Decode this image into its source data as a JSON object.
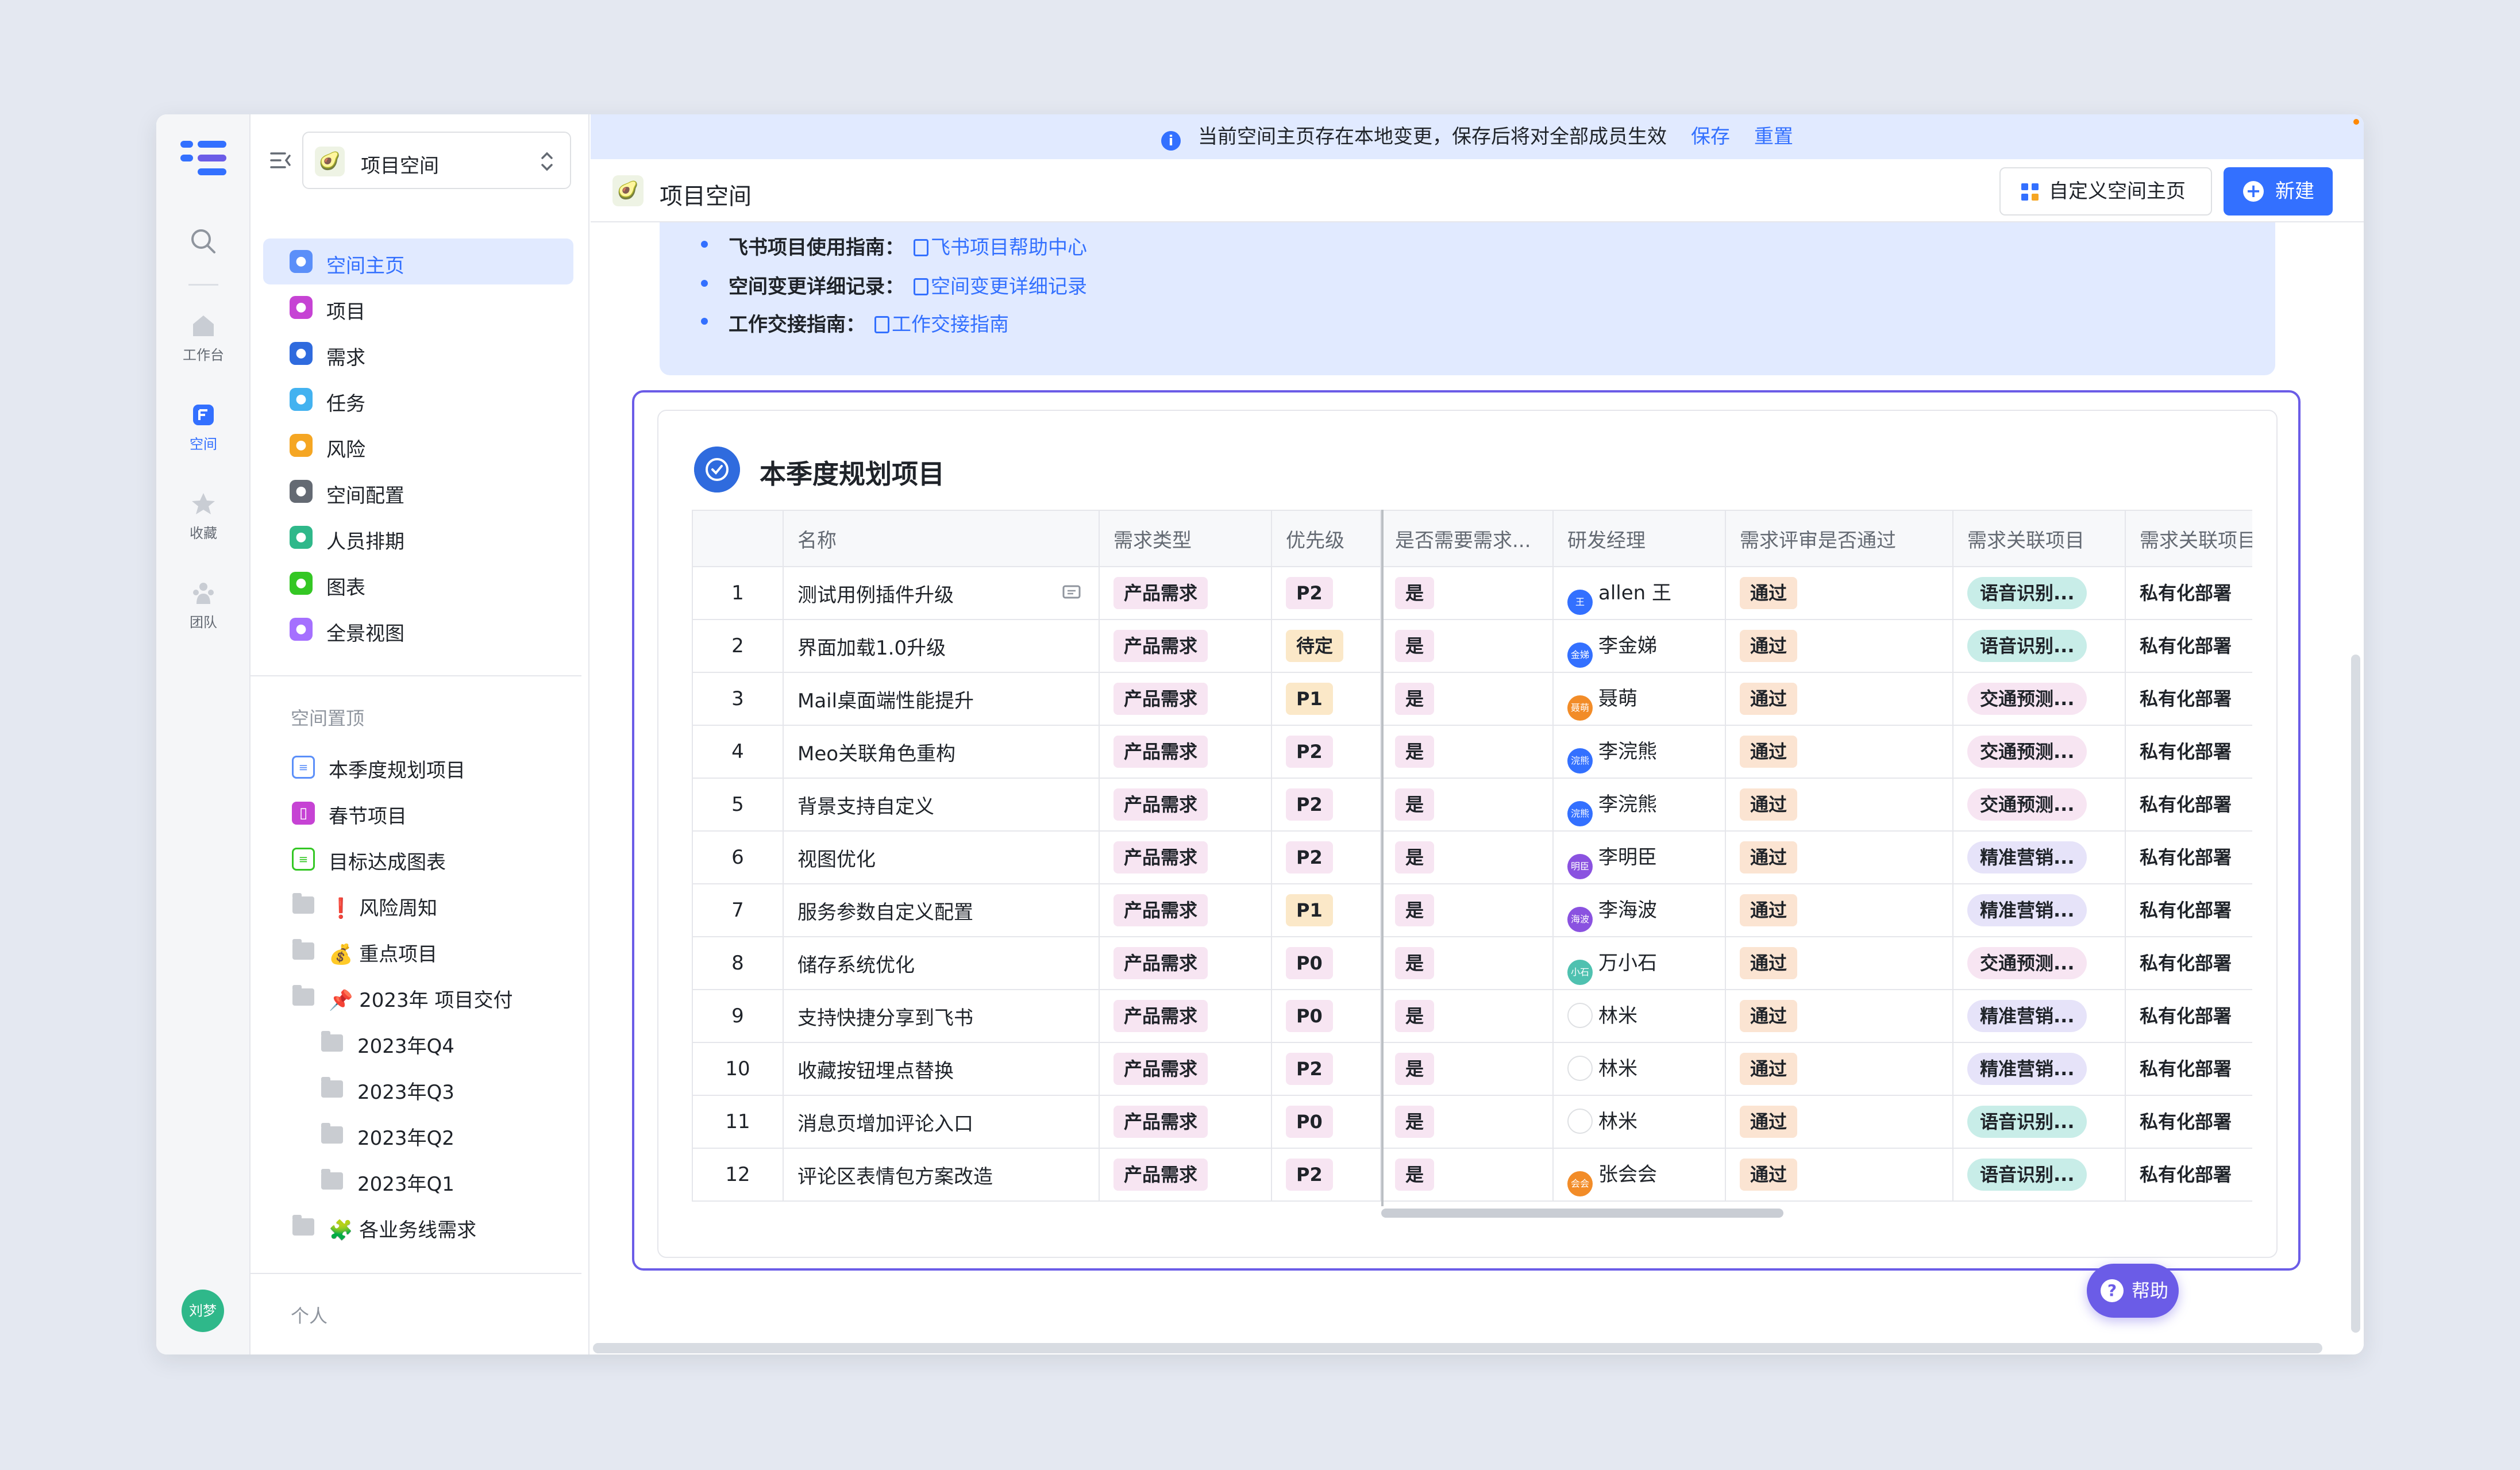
{
  "rail": {
    "items": [
      {
        "label": "工作台"
      },
      {
        "label": "空间"
      },
      {
        "label": "收藏"
      },
      {
        "label": "团队"
      }
    ],
    "avatar": "刘梦"
  },
  "sidebar": {
    "space_name": "项目空间",
    "nav": [
      {
        "label": "空间主页",
        "color": "#5b8ff9",
        "active": true
      },
      {
        "label": "项目",
        "color": "#c643d4"
      },
      {
        "label": "需求",
        "color": "#2f6bde"
      },
      {
        "label": "任务",
        "color": "#43b2f0"
      },
      {
        "label": "风险",
        "color": "#f5a623"
      },
      {
        "label": "空间配置",
        "color": "#646a73"
      },
      {
        "label": "人员排期",
        "color": "#2fb88a"
      },
      {
        "label": "图表",
        "color": "#34c724"
      },
      {
        "label": "全景视图",
        "color": "#a570ff"
      }
    ],
    "pinned_title": "空间置顶",
    "pinned": [
      {
        "label": "本季度规划项目",
        "icon": "list-icon",
        "indent": 0
      },
      {
        "label": "春节项目",
        "icon": "project-icon",
        "indent": 0
      },
      {
        "label": "目标达成图表",
        "icon": "chart-list-icon",
        "indent": 0
      },
      {
        "label": "❗ 风险周知",
        "icon": "folder-icon",
        "indent": 0
      },
      {
        "label": "💰 重点项目",
        "icon": "folder-icon",
        "indent": 0
      },
      {
        "label": "📌 2023年 项目交付",
        "icon": "folder-icon",
        "indent": 0
      },
      {
        "label": "2023年Q4",
        "icon": "folder-icon",
        "indent": 1
      },
      {
        "label": "2023年Q3",
        "icon": "folder-icon",
        "indent": 1
      },
      {
        "label": "2023年Q2",
        "icon": "folder-icon",
        "indent": 1
      },
      {
        "label": "2023年Q1",
        "icon": "folder-icon",
        "indent": 1
      },
      {
        "label": "🧩 各业务线需求",
        "icon": "folder-icon",
        "indent": 0
      }
    ],
    "personal_title": "个人"
  },
  "banner": {
    "text": "当前空间主页存在本地变更，保存后将对全部成员生效",
    "save": "保存",
    "reset": "重置"
  },
  "topbar": {
    "title": "项目空间",
    "customize": "自定义空间主页",
    "new": "新建"
  },
  "guide": [
    {
      "label": "飞书项目使用指南：",
      "link": "飞书项目帮助中心"
    },
    {
      "label": "空间变更详细记录：",
      "link": "空间变更详细记录"
    },
    {
      "label": "工作交接指南：",
      "link": "工作交接指南"
    }
  ],
  "block": {
    "title": "本季度规划项目",
    "columns": [
      "",
      "名称",
      "需求类型",
      "优先级",
      "是否需要需求...",
      "研发经理",
      "需求评审是否通过",
      "需求关联项目",
      "需求关联项目"
    ],
    "rows": [
      {
        "idx": "1",
        "name": "测试用例插件升级",
        "type": "产品需求",
        "priority": "P2",
        "need": "是",
        "manager": "allen 王",
        "av": "王",
        "av_color": "#3370ff",
        "review": "通过",
        "project": "语音识别...",
        "proj_style": "",
        "deploy": "私有化部署"
      },
      {
        "idx": "2",
        "name": "界面加载1.0升级",
        "type": "产品需求",
        "priority": "待定",
        "need": "是",
        "manager": "李金娣",
        "av": "金娣",
        "av_color": "#3370ff",
        "review": "通过",
        "project": "语音识别...",
        "proj_style": "",
        "deploy": "私有化部署"
      },
      {
        "idx": "3",
        "name": "Mail桌面端性能提升",
        "type": "产品需求",
        "priority": "P1",
        "need": "是",
        "manager": "聂萌",
        "av": "聂萌",
        "av_color": "#f28c28",
        "review": "通过",
        "project": "交通预测...",
        "proj_style": "pink",
        "deploy": "私有化部署"
      },
      {
        "idx": "4",
        "name": "Meo关联角色重构",
        "type": "产品需求",
        "priority": "P2",
        "need": "是",
        "manager": "李浣熊",
        "av": "浣熊",
        "av_color": "#3370ff",
        "review": "通过",
        "project": "交通预测...",
        "proj_style": "pink",
        "deploy": "私有化部署"
      },
      {
        "idx": "5",
        "name": "背景支持自定义",
        "type": "产品需求",
        "priority": "P2",
        "need": "是",
        "manager": "李浣熊",
        "av": "浣熊",
        "av_color": "#3370ff",
        "review": "通过",
        "project": "交通预测...",
        "proj_style": "pink",
        "deploy": "私有化部署"
      },
      {
        "idx": "6",
        "name": "视图优化",
        "type": "产品需求",
        "priority": "P2",
        "need": "是",
        "manager": "李明臣",
        "av": "明臣",
        "av_color": "#8a52e0",
        "review": "通过",
        "project": "精准营销...",
        "proj_style": "alt",
        "deploy": "私有化部署"
      },
      {
        "idx": "7",
        "name": "服务参数自定义配置",
        "type": "产品需求",
        "priority": "P1",
        "need": "是",
        "manager": "李海波",
        "av": "海波",
        "av_color": "#8a52e0",
        "review": "通过",
        "project": "精准营销...",
        "proj_style": "alt",
        "deploy": "私有化部署"
      },
      {
        "idx": "8",
        "name": "储存系统优化",
        "type": "产品需求",
        "priority": "P0",
        "need": "是",
        "manager": "万小石",
        "av": "小石",
        "av_color": "#4fc1b0",
        "review": "通过",
        "project": "交通预测...",
        "proj_style": "pink",
        "deploy": "私有化部署"
      },
      {
        "idx": "9",
        "name": "支持快捷分享到飞书",
        "type": "产品需求",
        "priority": "P0",
        "need": "是",
        "manager": "林米",
        "av": "",
        "av_color": "#ffffff",
        "review": "通过",
        "project": "精准营销...",
        "proj_style": "alt",
        "deploy": "私有化部署"
      },
      {
        "idx": "10",
        "name": "收藏按钮埋点替换",
        "type": "产品需求",
        "priority": "P2",
        "need": "是",
        "manager": "林米",
        "av": "",
        "av_color": "#ffffff",
        "review": "通过",
        "project": "精准营销...",
        "proj_style": "alt",
        "deploy": "私有化部署"
      },
      {
        "idx": "11",
        "name": "消息页增加评论入口",
        "type": "产品需求",
        "priority": "P0",
        "need": "是",
        "manager": "林米",
        "av": "",
        "av_color": "#ffffff",
        "review": "通过",
        "project": "语音识别...",
        "proj_style": "",
        "deploy": "私有化部署"
      },
      {
        "idx": "12",
        "name": "评论区表情包方案改造",
        "type": "产品需求",
        "priority": "P2",
        "need": "是",
        "manager": "张会会",
        "av": "会会",
        "av_color": "#f28c28",
        "review": "通过",
        "project": "语音识别...",
        "proj_style": "",
        "deploy": "私有化部署"
      }
    ]
  },
  "help": "帮助"
}
